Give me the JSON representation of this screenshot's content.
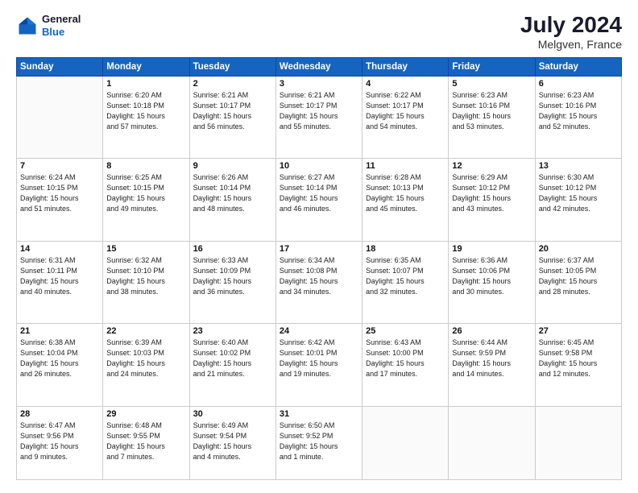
{
  "header": {
    "logo": {
      "line1": "General",
      "line2": "Blue"
    },
    "title": "July 2024",
    "location": "Melgven, France"
  },
  "weekdays": [
    "Sunday",
    "Monday",
    "Tuesday",
    "Wednesday",
    "Thursday",
    "Friday",
    "Saturday"
  ],
  "weeks": [
    [
      {
        "day": "",
        "info": ""
      },
      {
        "day": "1",
        "info": "Sunrise: 6:20 AM\nSunset: 10:18 PM\nDaylight: 15 hours\nand 57 minutes."
      },
      {
        "day": "2",
        "info": "Sunrise: 6:21 AM\nSunset: 10:17 PM\nDaylight: 15 hours\nand 56 minutes."
      },
      {
        "day": "3",
        "info": "Sunrise: 6:21 AM\nSunset: 10:17 PM\nDaylight: 15 hours\nand 55 minutes."
      },
      {
        "day": "4",
        "info": "Sunrise: 6:22 AM\nSunset: 10:17 PM\nDaylight: 15 hours\nand 54 minutes."
      },
      {
        "day": "5",
        "info": "Sunrise: 6:23 AM\nSunset: 10:16 PM\nDaylight: 15 hours\nand 53 minutes."
      },
      {
        "day": "6",
        "info": "Sunrise: 6:23 AM\nSunset: 10:16 PM\nDaylight: 15 hours\nand 52 minutes."
      }
    ],
    [
      {
        "day": "7",
        "info": "Sunrise: 6:24 AM\nSunset: 10:15 PM\nDaylight: 15 hours\nand 51 minutes."
      },
      {
        "day": "8",
        "info": "Sunrise: 6:25 AM\nSunset: 10:15 PM\nDaylight: 15 hours\nand 49 minutes."
      },
      {
        "day": "9",
        "info": "Sunrise: 6:26 AM\nSunset: 10:14 PM\nDaylight: 15 hours\nand 48 minutes."
      },
      {
        "day": "10",
        "info": "Sunrise: 6:27 AM\nSunset: 10:14 PM\nDaylight: 15 hours\nand 46 minutes."
      },
      {
        "day": "11",
        "info": "Sunrise: 6:28 AM\nSunset: 10:13 PM\nDaylight: 15 hours\nand 45 minutes."
      },
      {
        "day": "12",
        "info": "Sunrise: 6:29 AM\nSunset: 10:12 PM\nDaylight: 15 hours\nand 43 minutes."
      },
      {
        "day": "13",
        "info": "Sunrise: 6:30 AM\nSunset: 10:12 PM\nDaylight: 15 hours\nand 42 minutes."
      }
    ],
    [
      {
        "day": "14",
        "info": "Sunrise: 6:31 AM\nSunset: 10:11 PM\nDaylight: 15 hours\nand 40 minutes."
      },
      {
        "day": "15",
        "info": "Sunrise: 6:32 AM\nSunset: 10:10 PM\nDaylight: 15 hours\nand 38 minutes."
      },
      {
        "day": "16",
        "info": "Sunrise: 6:33 AM\nSunset: 10:09 PM\nDaylight: 15 hours\nand 36 minutes."
      },
      {
        "day": "17",
        "info": "Sunrise: 6:34 AM\nSunset: 10:08 PM\nDaylight: 15 hours\nand 34 minutes."
      },
      {
        "day": "18",
        "info": "Sunrise: 6:35 AM\nSunset: 10:07 PM\nDaylight: 15 hours\nand 32 minutes."
      },
      {
        "day": "19",
        "info": "Sunrise: 6:36 AM\nSunset: 10:06 PM\nDaylight: 15 hours\nand 30 minutes."
      },
      {
        "day": "20",
        "info": "Sunrise: 6:37 AM\nSunset: 10:05 PM\nDaylight: 15 hours\nand 28 minutes."
      }
    ],
    [
      {
        "day": "21",
        "info": "Sunrise: 6:38 AM\nSunset: 10:04 PM\nDaylight: 15 hours\nand 26 minutes."
      },
      {
        "day": "22",
        "info": "Sunrise: 6:39 AM\nSunset: 10:03 PM\nDaylight: 15 hours\nand 24 minutes."
      },
      {
        "day": "23",
        "info": "Sunrise: 6:40 AM\nSunset: 10:02 PM\nDaylight: 15 hours\nand 21 minutes."
      },
      {
        "day": "24",
        "info": "Sunrise: 6:42 AM\nSunset: 10:01 PM\nDaylight: 15 hours\nand 19 minutes."
      },
      {
        "day": "25",
        "info": "Sunrise: 6:43 AM\nSunset: 10:00 PM\nDaylight: 15 hours\nand 17 minutes."
      },
      {
        "day": "26",
        "info": "Sunrise: 6:44 AM\nSunset: 9:59 PM\nDaylight: 15 hours\nand 14 minutes."
      },
      {
        "day": "27",
        "info": "Sunrise: 6:45 AM\nSunset: 9:58 PM\nDaylight: 15 hours\nand 12 minutes."
      }
    ],
    [
      {
        "day": "28",
        "info": "Sunrise: 6:47 AM\nSunset: 9:56 PM\nDaylight: 15 hours\nand 9 minutes."
      },
      {
        "day": "29",
        "info": "Sunrise: 6:48 AM\nSunset: 9:55 PM\nDaylight: 15 hours\nand 7 minutes."
      },
      {
        "day": "30",
        "info": "Sunrise: 6:49 AM\nSunset: 9:54 PM\nDaylight: 15 hours\nand 4 minutes."
      },
      {
        "day": "31",
        "info": "Sunrise: 6:50 AM\nSunset: 9:52 PM\nDaylight: 15 hours\nand 1 minute."
      },
      {
        "day": "",
        "info": ""
      },
      {
        "day": "",
        "info": ""
      },
      {
        "day": "",
        "info": ""
      }
    ]
  ]
}
